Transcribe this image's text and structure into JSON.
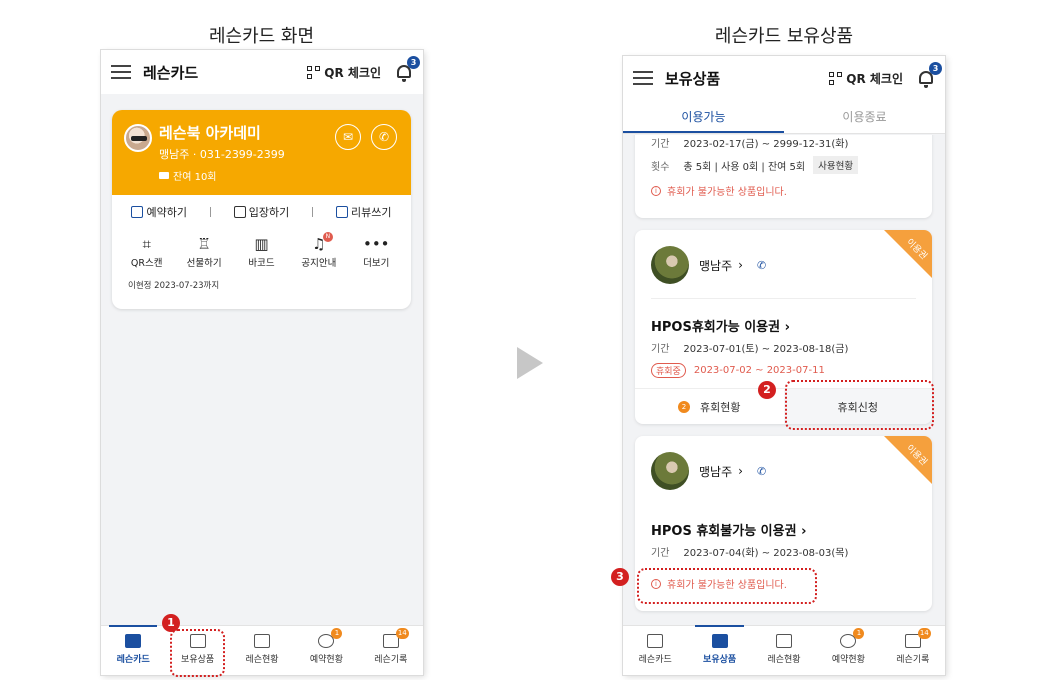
{
  "captions": {
    "left": "레슨카드 화면",
    "right": "레슨카드 보유상품"
  },
  "left": {
    "topbar": {
      "title": "레슨카드",
      "qr_label": "QR 체크인",
      "bell_badge": "3"
    },
    "card": {
      "academy": "레슨북 아카데미",
      "phone_line": "맹남주 · 031-2399-2399",
      "remain": "잔여 10회",
      "actions": [
        "예약하기",
        "입장하기",
        "리뷰쓰기"
      ],
      "menu": [
        {
          "label": "QR스캔",
          "icon": "qr-scan-icon",
          "glyph": "⌗"
        },
        {
          "label": "선물하기",
          "icon": "gift-icon",
          "glyph": "♖"
        },
        {
          "label": "바코드",
          "icon": "barcode-icon",
          "glyph": "▥"
        },
        {
          "label": "공지안내",
          "icon": "notice-bell-icon",
          "glyph": "♫",
          "badge": "N"
        },
        {
          "label": "더보기",
          "icon": "more-icon",
          "glyph": "•••"
        }
      ],
      "last_visit": "이현정 2023-07-23까지"
    }
  },
  "right": {
    "topbar": {
      "title": "보유상품",
      "qr_label": "QR 체크인",
      "bell_badge": "3"
    },
    "tabs": [
      "이용가능",
      "이용종료"
    ],
    "partial_card": {
      "period_label": "기간",
      "period_value": "2023-02-17(금) ~ 2999-12-31(화)",
      "count_label": "횟수",
      "count_value": "총 5회  |  사용 0회  |  잔여 5회",
      "usage_btn": "사용현황",
      "notice": "휴회가 불가능한 상품입니다."
    },
    "card1": {
      "owner": "맹남주",
      "corner": "이용권",
      "name": "HPOS휴회가능 이용권",
      "period_label": "기간",
      "period_value": "2023-07-01(토) ~ 2023-08-18(금)",
      "pause_tag": "휴회중",
      "pause_period": "2023-07-02 ~ 2023-07-11",
      "history_count": "2",
      "history_label": "휴회현황",
      "apply_label": "휴회신청"
    },
    "card2": {
      "owner": "맹남주",
      "corner": "이용권",
      "name": "HPOS 휴회불가능 이용권",
      "period_label": "기간",
      "period_value": "2023-07-04(화) ~ 2023-08-03(목)",
      "notice": "휴회가 불가능한 상품입니다."
    }
  },
  "bottom_nav": {
    "left": [
      {
        "label": "레슨카드",
        "active": true
      },
      {
        "label": "보유상품"
      },
      {
        "label": "레슨현황"
      },
      {
        "label": "예약현황",
        "badge": "1"
      },
      {
        "label": "레슨기록",
        "badge": "14"
      }
    ],
    "right": [
      {
        "label": "레슨카드"
      },
      {
        "label": "보유상품",
        "active": true
      },
      {
        "label": "레슨현황"
      },
      {
        "label": "예약현황",
        "badge": "1"
      },
      {
        "label": "레슨기록",
        "badge": "14"
      }
    ]
  },
  "steps": [
    "1",
    "2",
    "3"
  ],
  "colors": {
    "brand": "#1b4fa0",
    "card_orange": "#f6a800",
    "alert_red": "#e05b4e",
    "annotation_red": "#d32020"
  }
}
